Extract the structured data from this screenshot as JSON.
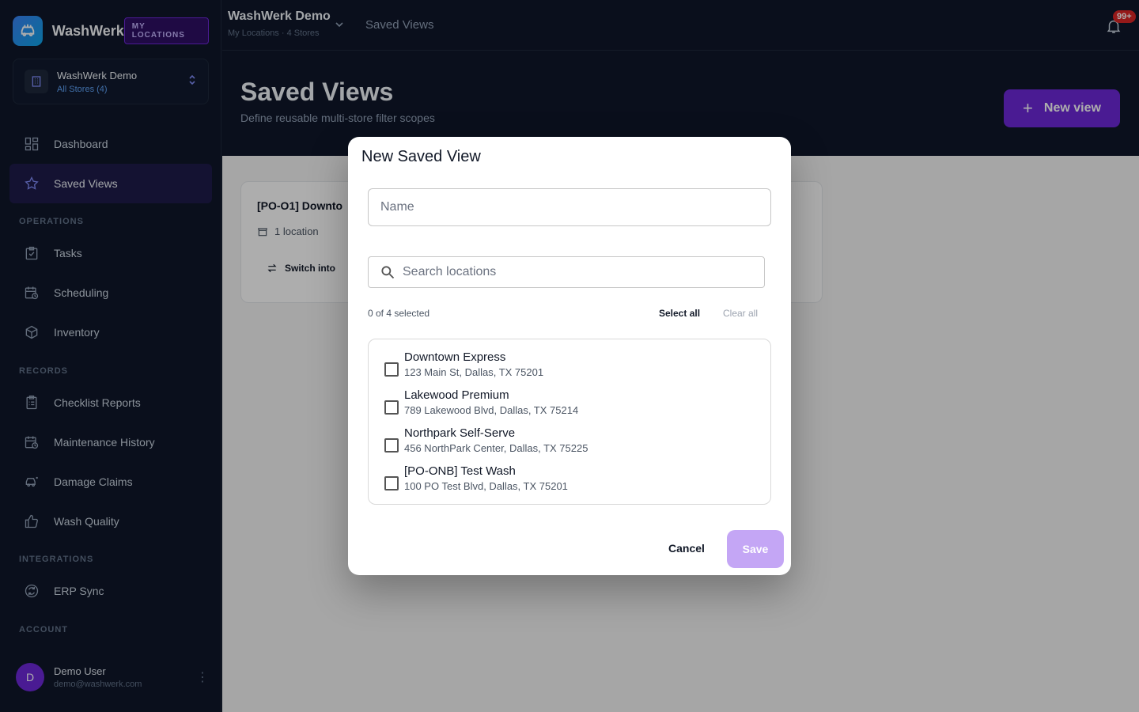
{
  "brand": {
    "name": "WashWerk",
    "badge": "MY LOCATIONS"
  },
  "org": {
    "name": "WashWerk Demo",
    "sub": "All Stores (4)"
  },
  "nav": {
    "dashboard": "Dashboard",
    "saved_views": "Saved Views",
    "sec_operations": "OPERATIONS",
    "tasks": "Tasks",
    "scheduling": "Scheduling",
    "inventory": "Inventory",
    "sec_records": "RECORDS",
    "checklist": "Checklist Reports",
    "maintenance": "Maintenance History",
    "damage": "Damage Claims",
    "quality": "Wash Quality",
    "sec_integrations": "INTEGRATIONS",
    "erp": "ERP Sync",
    "sec_account": "ACCOUNT"
  },
  "user": {
    "initial": "D",
    "name": "Demo User",
    "email": "demo@washwerk.com"
  },
  "topbar": {
    "title": "WashWerk Demo",
    "sub": "My Locations · 4 Stores",
    "page": "Saved Views",
    "notif": "99+"
  },
  "header": {
    "title": "Saved Views",
    "subtitle": "Define reusable multi-store filter scopes",
    "new_view": "New view"
  },
  "card": {
    "title": "[PO-O1] Downto",
    "meta": "1 location",
    "switch": "Switch into"
  },
  "modal": {
    "title": "New Saved View",
    "name_placeholder": "Name",
    "search_placeholder": "Search locations",
    "selected": "0 of 4 selected",
    "select_all": "Select all",
    "clear_all": "Clear all",
    "locations": [
      {
        "name": "Downtown Express",
        "address": "123 Main St, Dallas, TX 75201"
      },
      {
        "name": "Lakewood Premium",
        "address": "789 Lakewood Blvd, Dallas, TX 75214"
      },
      {
        "name": "Northpark Self-Serve",
        "address": "456 NorthPark Center, Dallas, TX 75225"
      },
      {
        "name": "[PO-ONB] Test Wash",
        "address": "100 PO Test Blvd, Dallas, TX 75201"
      }
    ],
    "cancel": "Cancel",
    "save": "Save"
  }
}
